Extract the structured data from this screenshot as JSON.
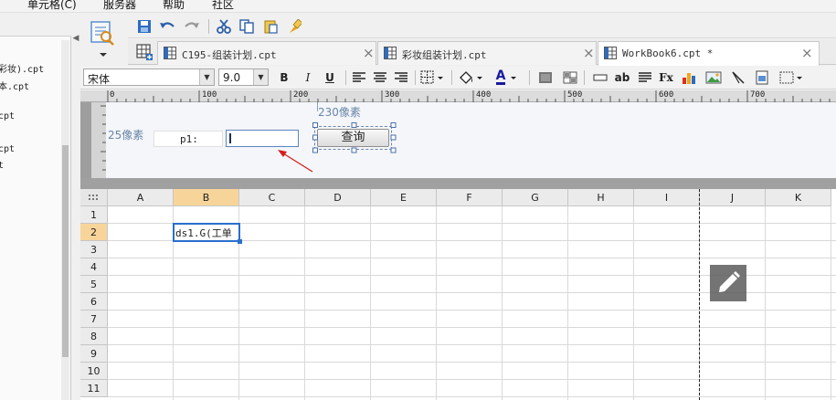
{
  "menubar": {
    "items": [
      "单元格(C)",
      "服务器",
      "帮助",
      "社区"
    ]
  },
  "left_panel": {
    "files": [
      "彩妆).cpt",
      "本.cpt",
      "cpt",
      "cpt",
      "t"
    ]
  },
  "tabs": [
    {
      "label": "C195-组装计划.cpt",
      "active": false
    },
    {
      "label": "彩妆组装计划.cpt",
      "active": false
    },
    {
      "label": "WorkBook6.cpt *",
      "active": true
    }
  ],
  "format_toolbar": {
    "font_name": "宋体",
    "font_size": "9.0",
    "bold": "B",
    "italic": "I",
    "underline": "U",
    "font_color_letter": "A",
    "text_btn": "ab",
    "formula_btn": "Fx"
  },
  "ruler": {
    "ticks": [
      "0",
      "100",
      "200",
      "300",
      "400",
      "500",
      "600",
      "700"
    ]
  },
  "param_pane": {
    "annot_left": "25像素",
    "annot_top": "230像素",
    "label_p1": "p1:",
    "query_button": "查询"
  },
  "grid": {
    "columns": [
      "A",
      "B",
      "C",
      "D",
      "E",
      "F",
      "G",
      "H",
      "I",
      "J",
      "K"
    ],
    "selected_column": "B",
    "rows": [
      "1",
      "2",
      "3",
      "4",
      "5",
      "6",
      "7",
      "8",
      "9",
      "10",
      "11"
    ],
    "selected_row": "2",
    "cell_b2": "ds1.G(工单"
  },
  "colors": {
    "selection_header": "#f7d59a",
    "active_cell_border": "#2a6fce",
    "arrow": "#d91b1b"
  }
}
